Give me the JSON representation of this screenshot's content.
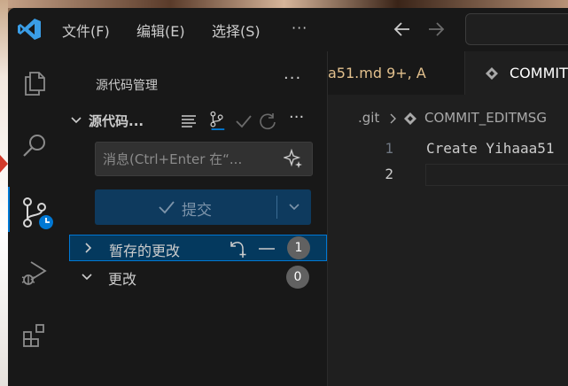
{
  "menu": {
    "file": "文件(F)",
    "edit": "编辑(E)",
    "select": "选择(S)",
    "more": "···"
  },
  "sidebar": {
    "title": "源代码管理",
    "more": "···",
    "repo_name": "源代码...",
    "repo_more": "···",
    "message_placeholder": "消息(Ctrl+Enter 在“...",
    "commit_label": "提交",
    "staged_label": "暂存的更改",
    "staged_count": "1",
    "changes_label": "更改",
    "changes_count": "0"
  },
  "editor": {
    "tab_inactive": "a51.md 9+, A",
    "tab_active": "COMMIT",
    "breadcrumb_git": ".git",
    "breadcrumb_file": "COMMIT_EDITMSG",
    "lines": [
      {
        "number": "1",
        "text": "Create Yihaaa51"
      },
      {
        "number": "2",
        "text": ""
      }
    ]
  },
  "colors": {
    "accent": "#0078d4",
    "commit_button": "#0e3a5e",
    "modified": "#e2c08d",
    "badge": "#616161"
  }
}
